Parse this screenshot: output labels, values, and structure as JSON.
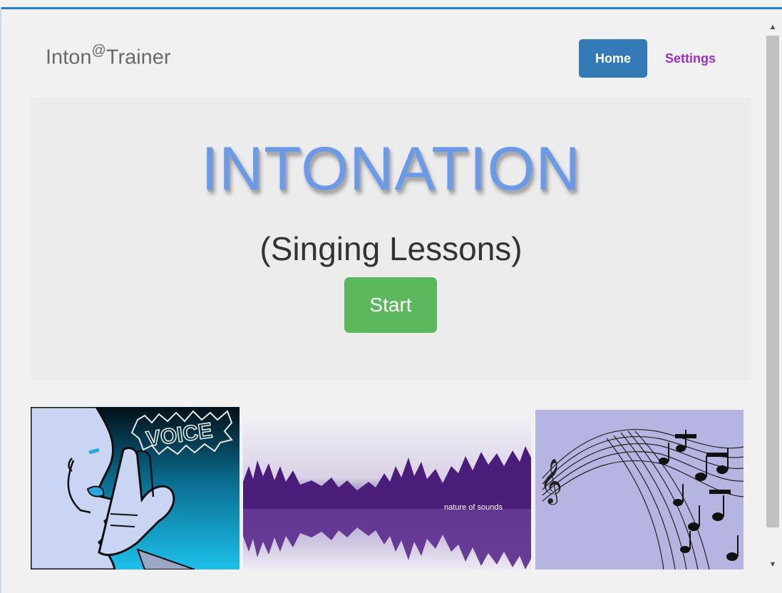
{
  "navbar": {
    "brand_prefix": "Inton",
    "brand_at": "@",
    "brand_suffix": "Trainer",
    "home_label": "Home",
    "settings_label": "Settings"
  },
  "hero": {
    "title": "INTONATION",
    "subtitle": "(Singing Lessons)",
    "start_label": "Start"
  },
  "images": {
    "voice_text": "VOICE",
    "nature_text": "nature of sounds"
  },
  "colors": {
    "nav_active": "#337ab7",
    "settings_link": "#9b30c9",
    "start_button": "#5cb85c",
    "title_blue": "#6b9be8"
  }
}
